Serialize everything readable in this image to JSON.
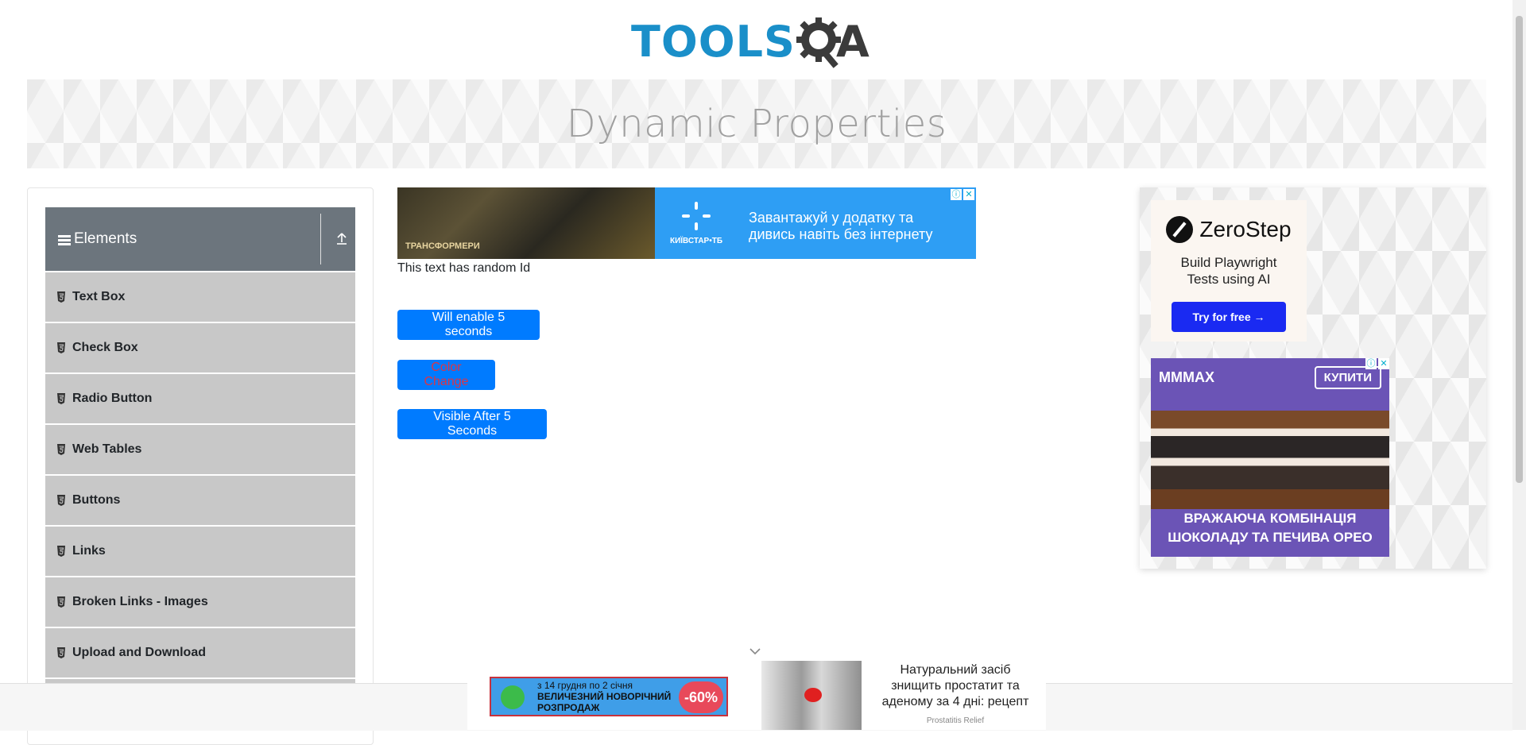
{
  "header": {
    "logo_text": "TOOLS",
    "logo_suffix": "A"
  },
  "banner": {
    "title": "Dynamic Properties"
  },
  "sidebar": {
    "group_title": "Elements",
    "items": [
      {
        "label": "Text Box"
      },
      {
        "label": "Check Box"
      },
      {
        "label": "Radio Button"
      },
      {
        "label": "Web Tables"
      },
      {
        "label": "Buttons"
      },
      {
        "label": "Links"
      },
      {
        "label": "Broken Links - Images"
      },
      {
        "label": "Upload and Download"
      }
    ]
  },
  "main": {
    "random_id_text": "This text has random Id",
    "enable_button": "Will enable 5 seconds",
    "color_button": "Color Change",
    "visible_button": "Visible After 5 Seconds"
  },
  "ads": {
    "top": {
      "caption": "ТРАНСФОРМЕРИ",
      "brand": "КИЇВСТАР•ТБ",
      "line1": "Завантажуй у додатку та",
      "line2": "дивись навіть без інтернету"
    },
    "zerostep": {
      "brand": "ZeroStep",
      "line1": "Build Playwright",
      "line2": "Tests using AI",
      "cta": "Try for free →"
    },
    "oreo": {
      "brand": "MMMAX",
      "cta": "КУПИТИ",
      "line1": "ВРАЖАЮЧА КОМБІНАЦІЯ",
      "line2": "ШОКОЛАДУ ТА ПЕЧИВА ОРЕО"
    },
    "bottom_sale": {
      "line1": "з 14 грудня по 2 січня",
      "line2": "ВЕЛИЧЕЗНИЙ НОВОРІЧНИЙ",
      "line3": "РОЗПРОДАЖ",
      "discount": "-60%"
    },
    "bottom_health": {
      "line1": "Натуральний засіб",
      "line2": "знищить простатит та",
      "line3": "аденому за 4 дні: рецепт",
      "source": "Prostatitis Relief"
    }
  },
  "colors": {
    "primary": "#007bff",
    "sidebar_header": "#6c757d",
    "menu_item": "#c8c8c8",
    "logo_blue": "#1a8fc9",
    "danger": "#dc3545"
  }
}
